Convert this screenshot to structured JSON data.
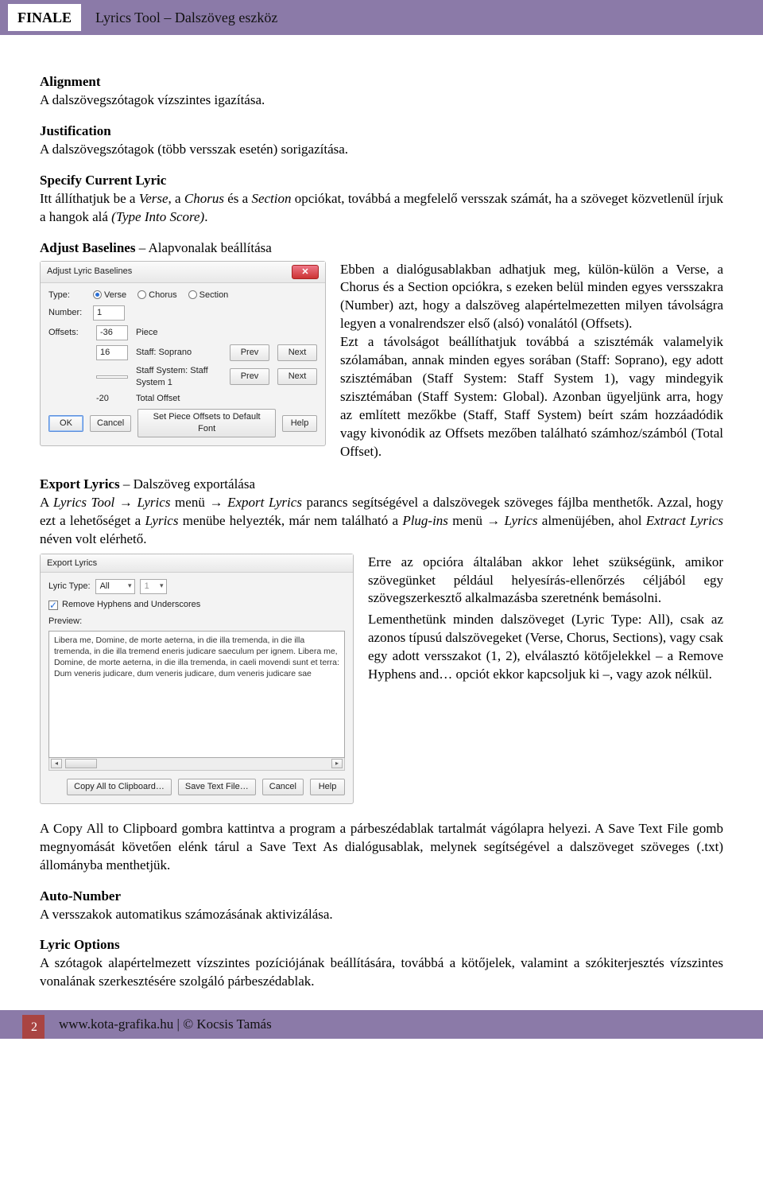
{
  "header": {
    "brand": "FINALE",
    "title": "Lyrics Tool – Dalszöveg eszköz"
  },
  "sections": {
    "alignment_title": "Alignment",
    "alignment_text": "A dalszövegszótagok vízszintes igazítása.",
    "justification_title": "Justification",
    "justification_text": "A dalszövegszótagok (több versszak esetén) sorigazítása.",
    "specify_title": "Specify Current Lyric",
    "specify_text_1": "Itt állíthatjuk be a ",
    "specify_i1": "Verse",
    "specify_text_2": ", a ",
    "specify_i2": "Chorus",
    "specify_text_3": " és a ",
    "specify_i3": "Section",
    "specify_text_4": " opciókat, továbbá a megfelelő versszak számát, ha a szöveget közvetlenül írjuk a hangok alá ",
    "specify_i4": "(Type Into Score)",
    "specify_text_5": ".",
    "adjust_title": "Adjust Baselines",
    "adjust_sub": " – Alapvonalak beállítása",
    "adjust_para": "Ebben a dialógusablakban adhatjuk meg, külön-külön a Verse, a Chorus és a Section opciókra, s ezeken belül minden egyes versszakra (Number) azt, hogy a dalszöveg alapértelmezetten milyen távolságra legyen a vonalrendszer első (alsó) vonalától (Offsets).",
    "adjust_para2": "Ezt a távolságot beállíthatjuk továbbá a szisztémák valamelyik szólamában, annak minden egyes sorában (Staff: Soprano), egy adott szisztémában (Staff System: Staff System 1), vagy mindegyik szisztémában (Staff System: Global). Azonban ügyeljünk arra, hogy az említett mezőkbe (Staff, Staff System) beírt szám hozzáadódik vagy kivonódik az Offsets mezőben található számhoz/számból (Total Offset).",
    "export_title": "Export Lyrics",
    "export_sub": " – Dalszöveg exportálása",
    "export_line1a": "A ",
    "export_line1b": "Lyrics Tool",
    "export_line1c": " ",
    "export_line1d": "Lyrics",
    "export_line1e": " menü ",
    "export_line1f": "Export Lyrics",
    "export_line1g": " parancs segítségével a dalszövegek szöveges fájlba menthetők. Azzal, hogy ezt a lehetőséget a ",
    "export_line1h": "Lyrics",
    "export_line1i": " menübe helyezték, már nem található a ",
    "export_line1j": "Plug-ins",
    "export_line1k": " menü ",
    "export_line1l": "Lyrics",
    "export_line1m": " almenüjében, ahol ",
    "export_line1n": "Extract Lyrics",
    "export_line1o": " néven volt elérhető.",
    "export_para2": "Erre az opcióra általában akkor lehet szükségünk, amikor szövegünket például helyesírás-ellenőrzés céljából egy szövegszerkesztő alkalmazásba szeretnénk bemásolni.",
    "export_para3": "Lementhetünk minden dalszöveget (Lyric Type: All), csak az azonos típusú dalszövegeket (Verse, Chorus, Sections), vagy csak egy adott versszakot (1, 2), elválasztó kötőjelekkel – a Remove Hyphens and… opciót ekkor kapcsoljuk ki –, vagy azok nélkül.",
    "copy_para": "A Copy All to Clipboard gombra kattintva a program a párbeszédablak tartalmát vágólapra helyezi. A Save Text File gomb megnyomását követően elénk tárul a Save Text As dialógusablak, melynek segítségével a dalszöveget szöveges (.txt) állományba menthetjük.",
    "auto_title": "Auto-Number",
    "auto_text": "A versszakok automatikus számozásának aktivizálása.",
    "lyricopt_title": "Lyric Options",
    "lyricopt_text": "A szótagok alapértelmezett vízszintes pozíciójának beállítására, továbbá a kötőjelek, valamint a szókiterjesztés vízszintes vonalának szerkesztésére szolgáló párbeszédablak."
  },
  "dlg_adjust": {
    "title": "Adjust Lyric Baselines",
    "type_lbl": "Type:",
    "verse": "Verse",
    "chorus": "Chorus",
    "section": "Section",
    "number_lbl": "Number:",
    "number_val": "1",
    "offsets_lbl": "Offsets:",
    "r1_val": "-36",
    "r1_txt": "Piece",
    "r2_val": "16",
    "r2_txt": "Staff:   Soprano",
    "r3_val": "",
    "r3_txt": "Staff System:  Staff System 1",
    "r4_val": "-20",
    "r4_txt": "Total Offset",
    "prev": "Prev",
    "next": "Next",
    "ok": "OK",
    "cancel": "Cancel",
    "setdef": "Set Piece Offsets to Default Font",
    "help": "Help"
  },
  "dlg_export": {
    "title": "Export Lyrics",
    "lyric_type_lbl": "Lyric Type:",
    "lyric_type_val": "All",
    "num_val": "1",
    "remove_chk": "Remove Hyphens and Underscores",
    "preview_lbl": "Preview:",
    "preview_text": "Libera me, Domine, de morte aeterna, in die illa tremenda,   in die illa tremenda, in die illa tremend eneris judicare saeculum per ignem. Libera me, Domine, de morte aeterna, in die illa tremenda, in caeli movendi sunt et terra: Dum veneris judicare, dum veneris judicare, dum veneris judicare sae",
    "copy_btn": "Copy All to Clipboard…",
    "save_btn": "Save Text File…",
    "cancel": "Cancel",
    "help": "Help"
  },
  "footer": {
    "page": "2",
    "text": "www.kota-grafika.hu | © Kocsis Tamás"
  },
  "arrow": "→"
}
